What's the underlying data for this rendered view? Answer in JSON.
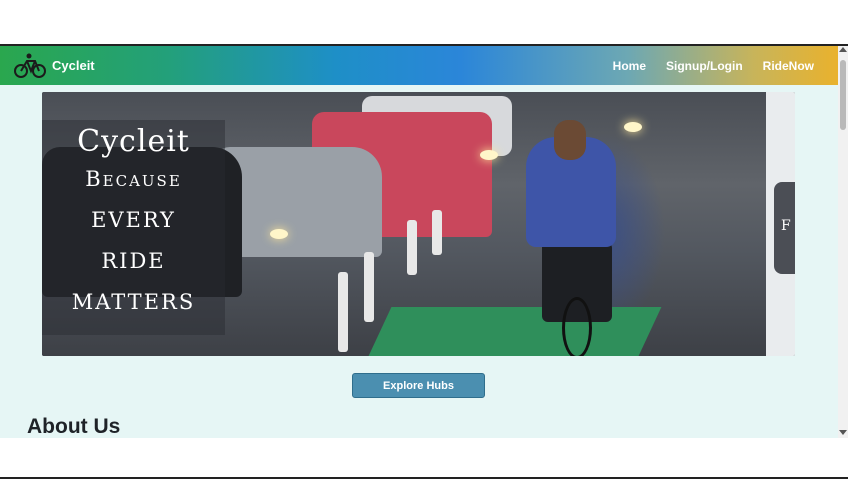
{
  "navbar": {
    "brand": "Cycleit",
    "brand_icon": "bicycle-icon",
    "links": [
      "Home",
      "Signup/Login",
      "RideNow"
    ]
  },
  "hero": {
    "title": "Cycleit",
    "lines": [
      "Because",
      "every",
      "ride",
      "matters"
    ],
    "next_slide_letter": "F"
  },
  "actions": {
    "explore_label": "Explore Hubs"
  },
  "about": {
    "heading": "About Us"
  },
  "colors": {
    "nav_gradient_start": "#2aa74e",
    "nav_gradient_mid": "#2b86d9",
    "nav_gradient_end": "#e9b22d",
    "button": "#4b8fb0",
    "page_background": "#e6f6f5"
  }
}
